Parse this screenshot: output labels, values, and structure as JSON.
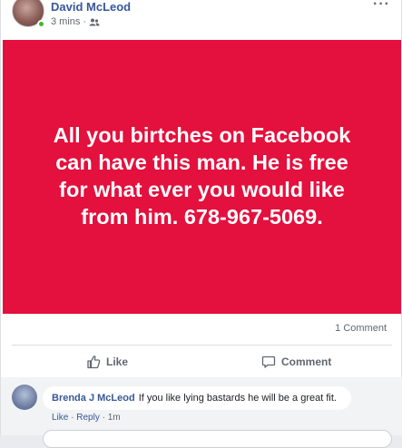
{
  "post": {
    "author": "David McLeod",
    "time": "3 mins",
    "separator": "·",
    "audience_icon": "friends-icon",
    "more_icon": "more-horizontal-icon",
    "more_label": "···",
    "banner_text": "All you birtches on Facebook\ncan have this man. He is free\nfor what ever you would like\nfrom him. 678-967-5069.",
    "banner_color": "#e4103d",
    "comment_count": "1 Comment"
  },
  "actions": {
    "like_label": "Like",
    "comment_label": "Comment"
  },
  "comment": {
    "author": "Brenda J McLeod",
    "text": "If you like lying bastards he will be a great fit.",
    "like_label": "Like",
    "separator": "·",
    "reply_label": "Reply",
    "time": "1m"
  }
}
